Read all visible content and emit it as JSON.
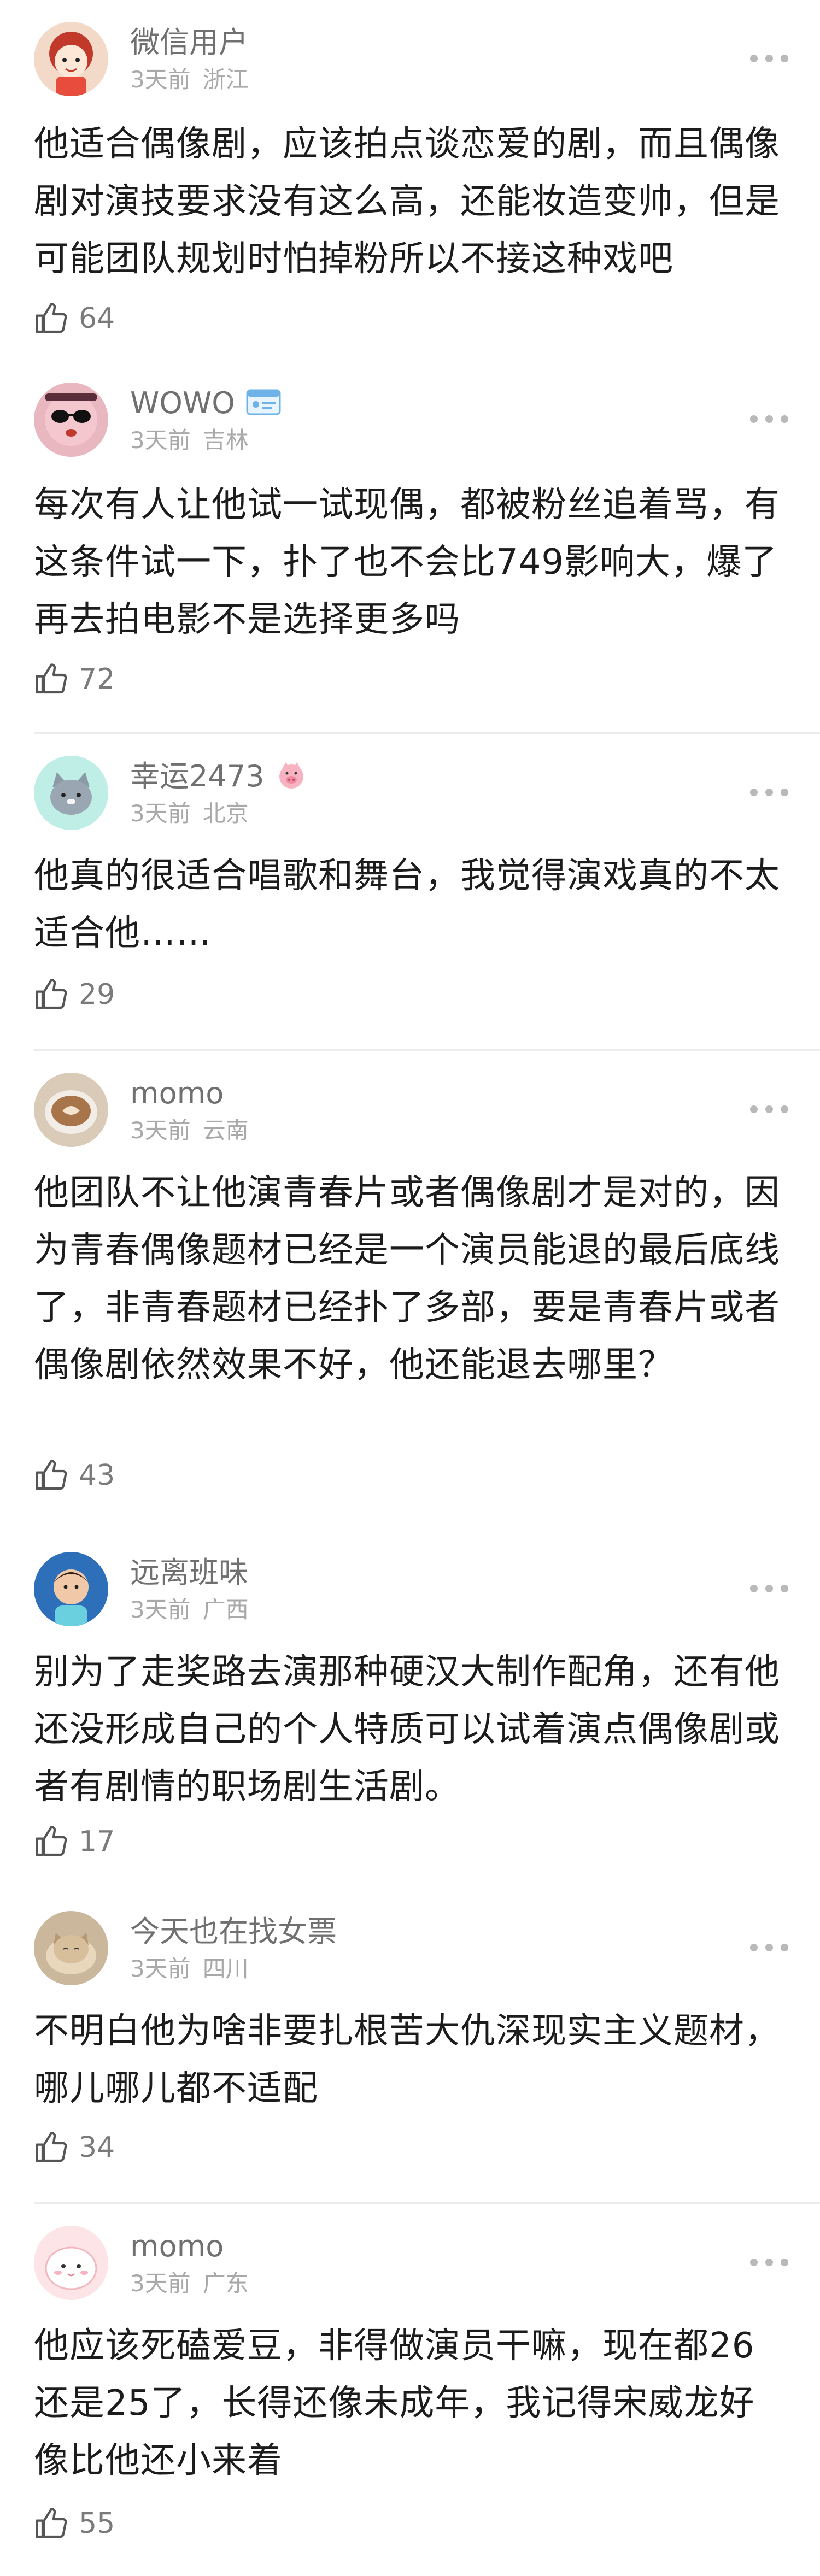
{
  "comments": [
    {
      "username": "微信用户",
      "time": "3天前",
      "location": "浙江",
      "text": "他适合偶像剧，应该拍点谈恋爱的剧，而且偶像剧对演技要求没有这么高，还能妆造变帅，但是可能团队规划时怕掉粉所以不接这种戏吧",
      "likes": "64",
      "avatar": "cartoon-girl-avatar"
    },
    {
      "username": "WOWO",
      "time": "3天前",
      "location": "吉林",
      "text": "每次有人让他试一试现偶，都被粉丝追着骂，有这条件试一下，扑了也不会比749影响大，爆了再去拍电影不是选择更多吗",
      "likes": "72",
      "avatar": "pink-sunglasses-avatar"
    },
    {
      "username": "幸运2473",
      "time": "3天前",
      "location": "北京",
      "text": "他真的很适合唱歌和舞台，我觉得演戏真的不太适合他……",
      "likes": "29",
      "avatar": "cartoon-cat-avatar"
    },
    {
      "username": "momo",
      "time": "3天前",
      "location": "云南",
      "text": "他团队不让他演青春片或者偶像剧才是对的，因为青春偶像题材已经是一个演员能退的最后底线了，非青春题材已经扑了多部，要是青春片或者偶像剧依然效果不好，他还能退去哪里？",
      "likes": "43",
      "avatar": "latte-cup-avatar"
    },
    {
      "username": "远离班味",
      "time": "3天前",
      "location": "广西",
      "text": "别为了走奖路去演那种硬汉大制作配角，还有他还没形成自己的个人特质可以试着演点偶像剧或者有剧情的职场剧生活剧。",
      "likes": "17",
      "avatar": "child-photo-avatar"
    },
    {
      "username": "今天也在找女票",
      "time": "3天前",
      "location": "四川",
      "text": "不明白他为啥非要扎根苦大仇深现实主义题材，哪儿哪儿都不适配",
      "likes": "34",
      "avatar": "cat-photo-avatar"
    },
    {
      "username": "momo",
      "time": "3天前",
      "location": "广东",
      "text": "他应该死磕爱豆，非得做演员干嘛，现在都26还是25了，长得还像未成年，我记得宋威龙好像比他还小来着",
      "likes": "55",
      "avatar": "pink-blob-avatar"
    }
  ]
}
